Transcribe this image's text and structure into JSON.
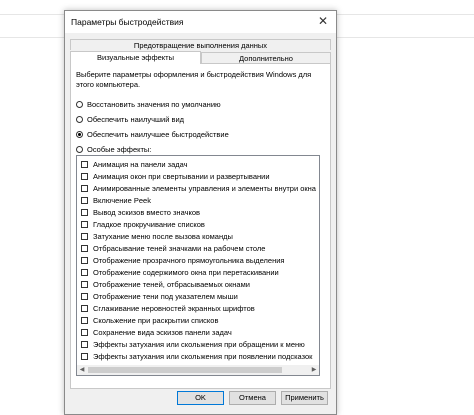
{
  "dialog": {
    "title": "Параметры быстродействия",
    "close_glyph": "✕"
  },
  "tabs": {
    "top": "Предотвращение выполнения данных",
    "visual": "Визуальные эффекты",
    "advanced": "Дополнительно"
  },
  "description": "Выберите параметры оформления и быстродействия Windows для этого компьютера.",
  "radios": [
    {
      "label": "Восстановить значения по умолчанию",
      "selected": false
    },
    {
      "label": "Обеспечить наилучший вид",
      "selected": false
    },
    {
      "label": "Обеспечить наилучшее быстродействие",
      "selected": true
    },
    {
      "label": "Особые эффекты:",
      "selected": false
    }
  ],
  "effects": [
    "Анимация на панели задач",
    "Анимация окон при свертывании и развертывании",
    "Анимированные элементы управления и элементы внутри окна",
    "Включение Peek",
    "Вывод эскизов вместо значков",
    "Гладкое прокручивание списков",
    "Затухание меню после вызова команды",
    "Отбрасывание теней значками на рабочем столе",
    "Отображение прозрачного прямоугольника выделения",
    "Отображение содержимого окна при перетаскивании",
    "Отображение теней, отбрасываемых окнами",
    "Отображение тени под указателем мыши",
    "Сглаживание неровностей экранных шрифтов",
    "Скольжение при раскрытии списков",
    "Сохранение вида эскизов панели задач",
    "Эффекты затухания или скольжения при обращении к меню",
    "Эффекты затухания или скольжения при появлении подсказок"
  ],
  "scroll": {
    "left": "◀",
    "right": "▶"
  },
  "buttons": {
    "ok": "OK",
    "cancel": "Отмена",
    "apply": "Применить"
  }
}
